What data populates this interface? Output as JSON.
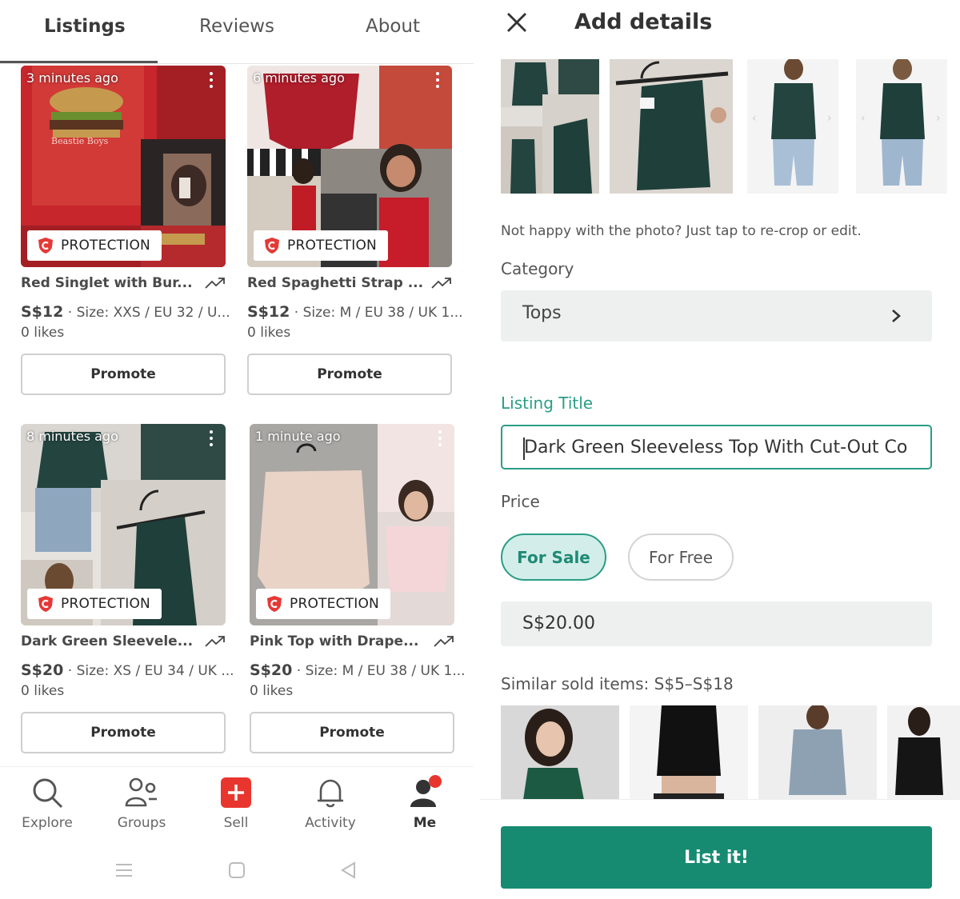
{
  "left": {
    "tabs": [
      {
        "label": "Listings",
        "active": true
      },
      {
        "label": "Reviews",
        "active": false
      },
      {
        "label": "About",
        "active": false
      }
    ],
    "listings": [
      {
        "time": "3 minutes ago",
        "protection": "PROTECTION",
        "title": "Red Singlet with Bur...",
        "price": "S$12",
        "details": " · Size: XXS / EU 32 / U...",
        "likes": "0 likes",
        "promote": "Promote",
        "shirt_print": "Beastie Boys"
      },
      {
        "time": "6 minutes ago",
        "protection": "PROTECTION",
        "title": "Red Spaghetti Strap ...",
        "price": "S$12",
        "details": " · Size: M / EU 38 / UK 1...",
        "likes": "0 likes",
        "promote": "Promote"
      },
      {
        "time": "8 minutes ago",
        "protection": "PROTECTION",
        "title": "Dark Green Sleevele...",
        "price": "S$20",
        "details": " · Size: XS / EU 34 / UK ...",
        "likes": "0 likes",
        "promote": "Promote"
      },
      {
        "time": "1 minute ago",
        "protection": "PROTECTION",
        "title": "Pink Top with Drape...",
        "price": "S$20",
        "details": " · Size: M / EU 38 / UK 1...",
        "likes": "0 likes",
        "promote": "Promote"
      }
    ],
    "nav": [
      {
        "label": "Explore",
        "icon": "search-icon"
      },
      {
        "label": "Groups",
        "icon": "groups-icon"
      },
      {
        "label": "Sell",
        "icon": "plus-icon"
      },
      {
        "label": "Activity",
        "icon": "bell-icon"
      },
      {
        "label": "Me",
        "icon": "profile-icon",
        "active": true
      }
    ]
  },
  "right": {
    "title": "Add details",
    "hint": "Not happy with the photo? Just tap to re-crop or edit.",
    "category_label": "Category",
    "category_value": "Tops",
    "listing_title_label": "Listing Title",
    "listing_title_value": "Dark Green Sleeveless Top With Cut-Out Co",
    "price_label": "Price",
    "price_options": [
      "For Sale",
      "For Free"
    ],
    "price_value": "S$20.00",
    "similar_label": "Similar sold items: S$5–S$18",
    "list_button": "List it!"
  },
  "colors": {
    "accent": "#178b72",
    "accent_light": "#d3eeea",
    "badge_red": "#e53935"
  }
}
